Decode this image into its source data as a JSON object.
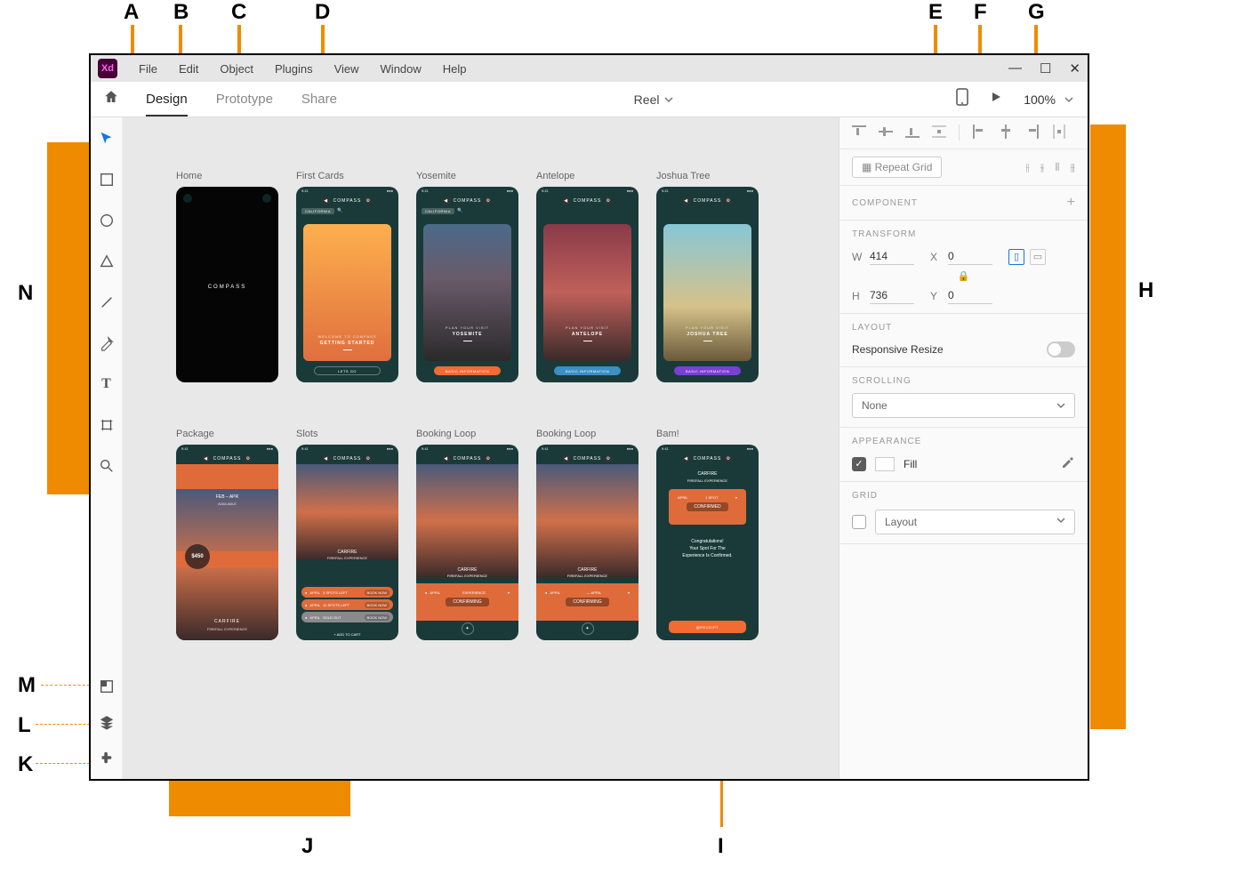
{
  "callouts": {
    "A": "A",
    "B": "B",
    "C": "C",
    "D": "D",
    "E": "E",
    "F": "F",
    "G": "G",
    "H": "H",
    "I": "I",
    "J": "J",
    "K": "K",
    "L": "L",
    "M": "M",
    "N": "N"
  },
  "menu": {
    "file": "File",
    "edit": "Edit",
    "object": "Object",
    "plugins": "Plugins",
    "view": "View",
    "window": "Window",
    "help": "Help"
  },
  "window_controls": {
    "min": "—",
    "max": "☐",
    "close": "✕"
  },
  "modebar": {
    "design": "Design",
    "prototype": "Prototype",
    "share": "Share",
    "doc_title": "Reel",
    "zoom": "100%"
  },
  "artboards": [
    {
      "name": "Home"
    },
    {
      "name": "First Cards",
      "pill": "CALIFORNIA",
      "sub": "WELCOME TO COMPASS",
      "title": "GETTING STARTED",
      "btn": "LETS GO"
    },
    {
      "name": "Yosemite",
      "pill": "CALIFORNIA",
      "sub": "PLAN YOUR VISIT",
      "title": "YOSEMITE",
      "btn": "BASIC INFORMATION"
    },
    {
      "name": "Antelope",
      "sub": "PLAN YOUR VISIT",
      "title": "ANTELOPE",
      "btn": "BASIC INFORMATION"
    },
    {
      "name": "Joshua Tree",
      "sub": "PLAN YOUR VISIT",
      "title": "JOSHUA TREE",
      "btn": "BASIC INFORMATION"
    },
    {
      "name": "Package",
      "dates": "FEB – APR",
      "avail": "AVAILABLE",
      "price": "$450",
      "title": "CARFIRE",
      "sub2": "FIREFALL EXPERIENCE"
    },
    {
      "name": "Slots",
      "title": "CARFIRE",
      "sub2": "FIREFALL EXPERIENCE",
      "slots": [
        {
          "label": "APRIL",
          "info": "3 SPOTS LEFT",
          "action": "BOOK NOW"
        },
        {
          "label": "APRIL",
          "info": "12 SPOTS LEFT",
          "action": "BOOK NOW"
        },
        {
          "label": "APRIL",
          "info": "SOLD OUT",
          "action": "BOOK NOW"
        }
      ],
      "cart": "ADD TO CART"
    },
    {
      "name": "Booking Loop",
      "title": "CARFIRE",
      "sub2": "FIREFALL EXPERIENCE",
      "rowlabel": "APRIL",
      "rowmid": "EXPERIENCE",
      "status": "CONFIRMING"
    },
    {
      "name": "Booking Loop",
      "title": "CARFIRE",
      "sub2": "FIREFALL EXPERIENCE",
      "rowlabel": "APRIL",
      "rowmid": "— APRIL",
      "status": "CONFIRMING"
    },
    {
      "name": "Bam!",
      "title": "CARFIRE",
      "sub2": "FIREFALL EXPERIENCE",
      "rowlabel": "APRIL",
      "rowmid": "1 SPOT",
      "status": "CONFIRMED",
      "msg1": "Congratulations!",
      "msg2": "Your Spot For The",
      "msg3": "Experience Is Confirmed.",
      "receipt": "RECEIPT"
    }
  ],
  "brand": "COMPASS",
  "home_brand": "COMPASS",
  "panel": {
    "repeat_grid": "Repeat Grid",
    "component": "COMPONENT",
    "transform": "TRANSFORM",
    "w_label": "W",
    "w_val": "414",
    "h_label": "H",
    "h_val": "736",
    "x_label": "X",
    "x_val": "0",
    "y_label": "Y",
    "y_val": "0",
    "layout": "LAYOUT",
    "responsive": "Responsive Resize",
    "scrolling": "SCROLLING",
    "scrolling_val": "None",
    "appearance": "APPEARANCE",
    "fill": "Fill",
    "grid": "GRID",
    "grid_val": "Layout"
  }
}
